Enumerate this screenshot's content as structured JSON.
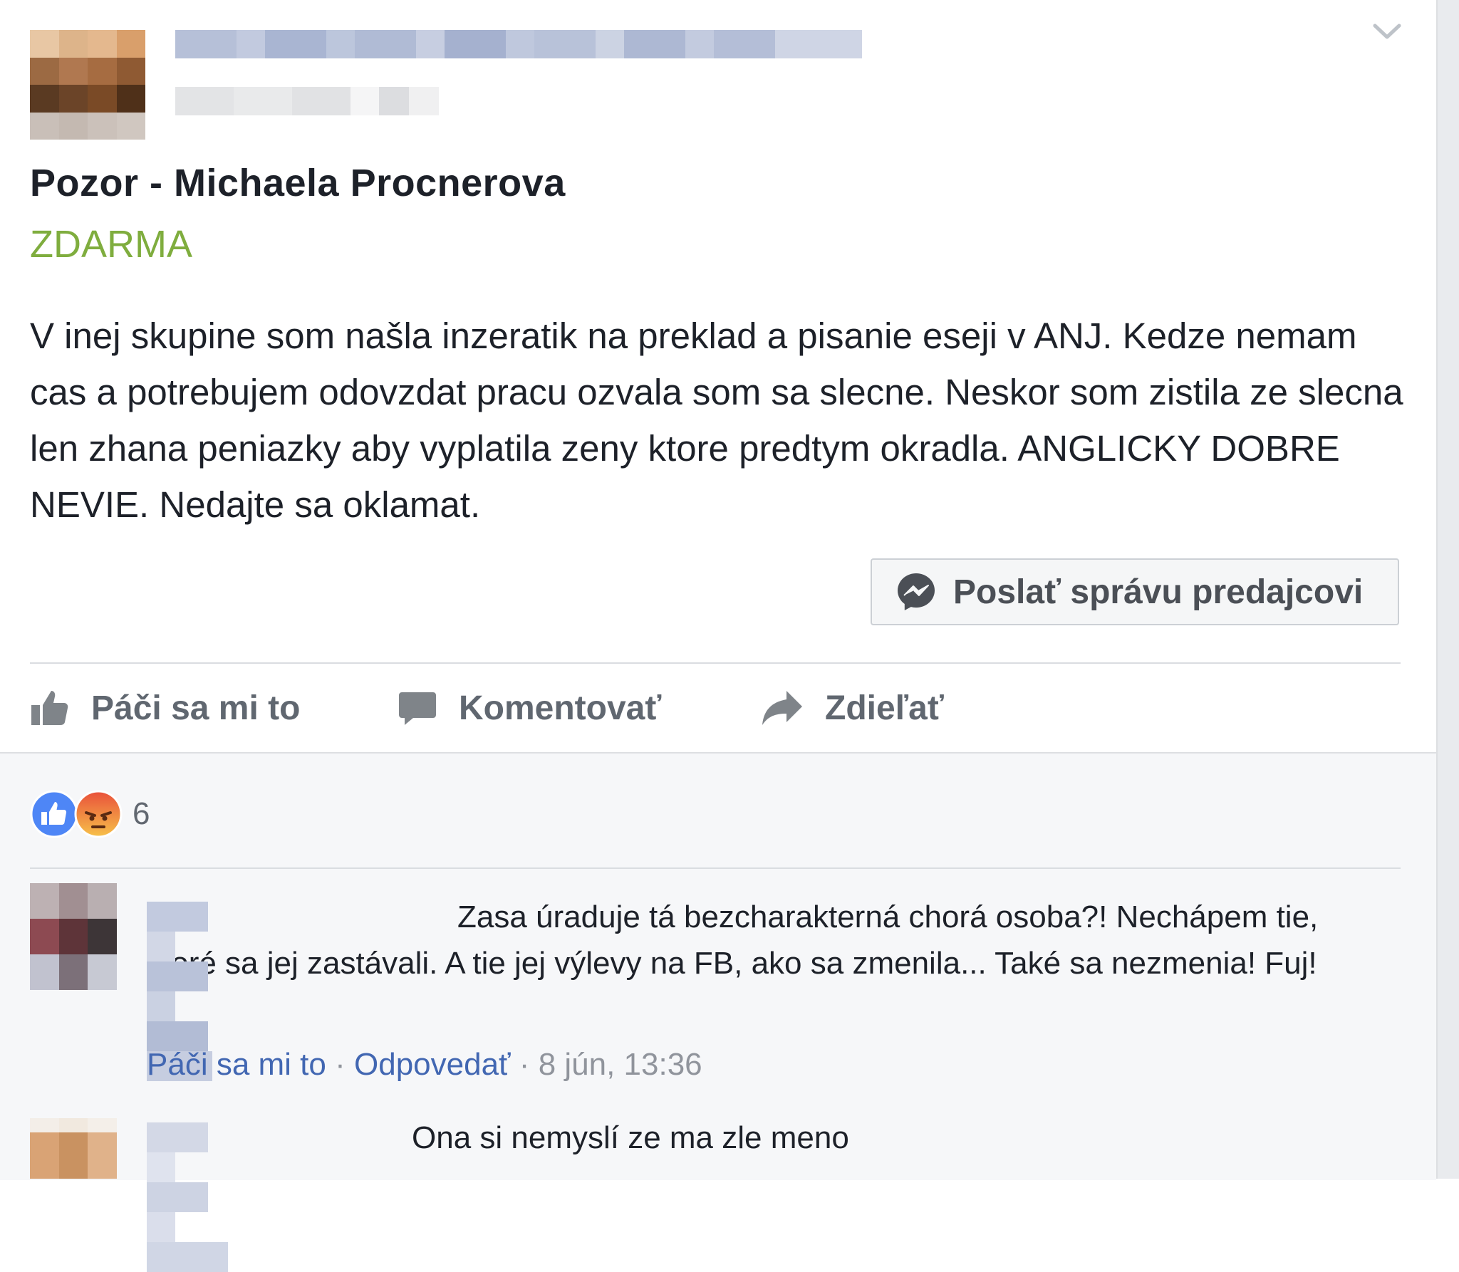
{
  "post": {
    "title": "Pozor - Michaela Procnerova",
    "price": "ZDARMA",
    "body": "V inej skupine som našla inzeratik na preklad a pisanie eseji v ANJ. Kedze nemam cas a potrebujem odovzdat pracu ozvala som sa slecne. Neskor som zistila ze slecna len zhana peniazky aby vyplatila zeny ktore predtym okradla. ANGLICKY DOBRE NEVIE. Nedajte sa oklamat.",
    "message_button_label": "Poslať správu predajcovi"
  },
  "actions": {
    "like": "Páči sa mi to",
    "comment": "Komentovať",
    "share": "Zdieľať"
  },
  "reactions": {
    "types": [
      "like-icon",
      "angry-icon"
    ],
    "count": "6"
  },
  "comments": [
    {
      "text": "Zasa úraduje tá bezcharakterná chorá osoba?! Nechápem tie, ktoré sa jej zastávali. A tie jej výlevy na FB, ako sa zmenila... Také sa nezmenia! Fuj!",
      "like_label": "Páči sa mi to",
      "reply_label": "Odpovedať",
      "timestamp": "8 jún, 13:36"
    },
    {
      "text": "Ona si nemyslí ze ma zle meno"
    }
  ],
  "colors": {
    "price_green": "#7fad3e",
    "link_blue": "#4267b2",
    "like_blue": "#4e86f6",
    "angry_orange": "#f2a23a"
  }
}
